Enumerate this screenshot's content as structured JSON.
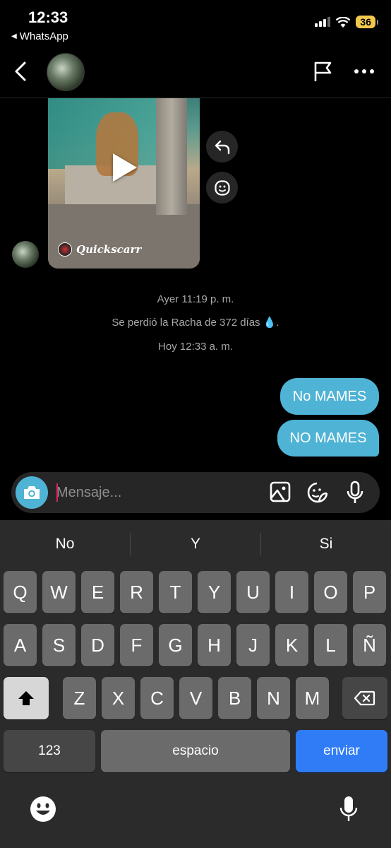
{
  "status_bar": {
    "time": "12:33",
    "back_app": "WhatsApp",
    "battery": "36"
  },
  "header": {
    "back_icon": "chevron-left-icon",
    "flag_icon": "flag-icon",
    "more_icon": "ellipsis-icon"
  },
  "shared_post": {
    "author": "Quickscarr",
    "reply_icon": "reply-arrow-icon",
    "react_icon": "emoji-react-icon"
  },
  "system_messages": {
    "yesterday": "Ayer 11:19 p. m.",
    "streak_lost": "Se perdió la Racha de 372 días 💧.",
    "today": "Hoy 12:33 a. m."
  },
  "messages": [
    {
      "text": "No MAMES"
    },
    {
      "text": "NO MAMES"
    }
  ],
  "composer": {
    "placeholder": "Mensaje...",
    "value": ""
  },
  "keyboard": {
    "suggestions": [
      "No",
      "Y",
      "Si"
    ],
    "row1": [
      "Q",
      "W",
      "E",
      "R",
      "T",
      "Y",
      "U",
      "I",
      "O",
      "P"
    ],
    "row2": [
      "A",
      "S",
      "D",
      "F",
      "G",
      "H",
      "J",
      "K",
      "L",
      "Ñ"
    ],
    "row3": [
      "Z",
      "X",
      "C",
      "V",
      "B",
      "N",
      "M"
    ],
    "numbers_label": "123",
    "space_label": "espacio",
    "send_label": "enviar"
  },
  "colors": {
    "bubble": "#4fb3d5",
    "send_key": "#2f7cf6",
    "battery": "#f2c94c"
  }
}
